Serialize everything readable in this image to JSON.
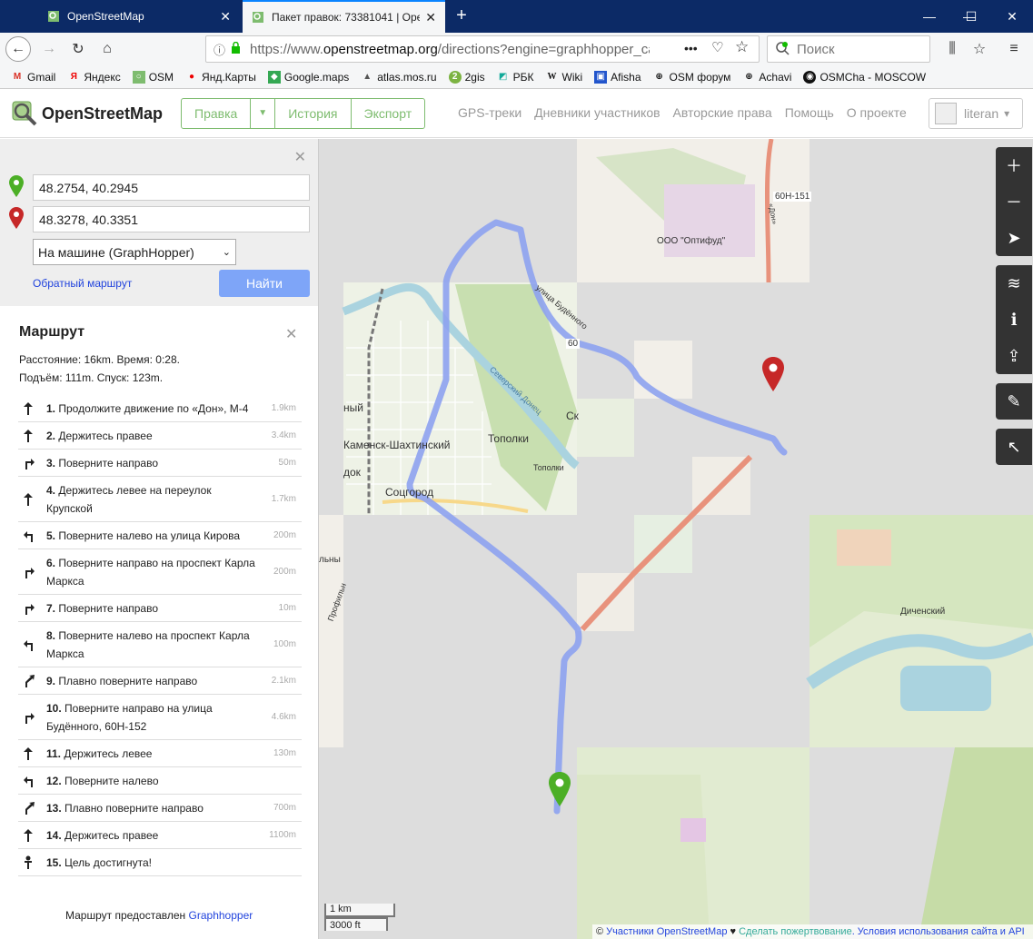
{
  "browser": {
    "tabs": [
      {
        "title": "OpenStreetMap",
        "active": false
      },
      {
        "title": "Пакет правок: 73381041 | OpenStreetMap",
        "active": true
      }
    ],
    "url_prefix": "https://www.",
    "url_domain": "openstreetmap.org",
    "url_path": "/directions?engine=graphhopper_car&r",
    "search_placeholder": "Поиск",
    "bookmarks": [
      "Gmail",
      "Яндекс",
      "OSM",
      "Янд.Карты",
      "Google.maps",
      "atlas.mos.ru",
      "2gis",
      "РБК",
      "Wiki",
      "Afisha",
      "OSM форум",
      "Achavi",
      "OSMCha - MOSCOW"
    ]
  },
  "osm": {
    "logo": "OpenStreetMap",
    "edit": "Правка",
    "history": "История",
    "export": "Экспорт",
    "links": [
      "GPS-треки",
      "Дневники участников",
      "Авторские права",
      "Помощь",
      "О проекте"
    ],
    "user": "literan",
    "user_caret": "▾"
  },
  "directions": {
    "from": "48.2754, 40.2945",
    "to": "48.3278, 40.3351",
    "engine": "На машине (GraphHopper)",
    "reverse": "Обратный маршрут",
    "go": "Найти"
  },
  "route": {
    "title": "Маршрут",
    "summary1": "Расстояние: 16km. Время: 0:28.",
    "summary2": "Подъём: 111m. Спуск: 123m.",
    "steps": [
      {
        "n": "1.",
        "text": "Продолжите движение по «Дон», M-4",
        "dist": "1.9km",
        "icon": "straight"
      },
      {
        "n": "2.",
        "text": "Держитесь правее",
        "dist": "3.4km",
        "icon": "straight"
      },
      {
        "n": "3.",
        "text": "Поверните направо",
        "dist": "50m",
        "icon": "right"
      },
      {
        "n": "4.",
        "text": "Держитесь левее на переулок Крупской",
        "dist": "1.7km",
        "icon": "straight"
      },
      {
        "n": "5.",
        "text": "Поверните налево на улица Кирова",
        "dist": "200m",
        "icon": "left"
      },
      {
        "n": "6.",
        "text": "Поверните направо на проспект Карла Маркса",
        "dist": "200m",
        "icon": "right"
      },
      {
        "n": "7.",
        "text": "Поверните направо",
        "dist": "10m",
        "icon": "right"
      },
      {
        "n": "8.",
        "text": "Поверните налево на проспект Карла Маркса",
        "dist": "100m",
        "icon": "left"
      },
      {
        "n": "9.",
        "text": "Плавно поверните направо",
        "dist": "2.1km",
        "icon": "slight-right"
      },
      {
        "n": "10.",
        "text": "Поверните направо на улица Будённого, 60Н-152",
        "dist": "4.6km",
        "icon": "right"
      },
      {
        "n": "11.",
        "text": "Держитесь левее",
        "dist": "130m",
        "icon": "straight"
      },
      {
        "n": "12.",
        "text": "Поверните налево",
        "dist": "",
        "icon": "left"
      },
      {
        "n": "13.",
        "text": "Плавно поверните направо",
        "dist": "700m",
        "icon": "slight-right"
      },
      {
        "n": "14.",
        "text": "Держитесь правее",
        "dist": "1100m",
        "icon": "straight"
      },
      {
        "n": "15.",
        "text": "Цель достигнута!",
        "dist": "",
        "icon": "destination"
      }
    ],
    "credit_prefix": "Маршрут предоставлен ",
    "credit_link": "Graphhopper"
  },
  "map": {
    "labels": {
      "kamensk": "Каменск-Шахтинский",
      "topolki": "Тополки",
      "topolki2": "Тополки",
      "socgorod": "Соцгород",
      "dichensky": "Диченский",
      "optifud": "ООО \"Оптифуд\"",
      "road": "60Н-151",
      "budennogo": "улица Будённого",
      "don_river": "Северский Донец",
      "don_road": "«Дон»",
      "n60": "60",
      "ny": "ный",
      "dok": "док",
      "sk": "Ск",
      "elny": "льны",
      "profil": "Профильн"
    },
    "scale_km": "1 km",
    "scale_ft": "3000 ft",
    "attrib_c": "© ",
    "attrib_osm": "Участники OpenStreetMap",
    "attrib_heart": " ♥ ",
    "attrib_donate": "Сделать пожертвование",
    "attrib_terms": ". Условия использования сайта и API"
  },
  "colors": {
    "osm_green": "#7ebc6f",
    "route_line": "#8da2f0",
    "start_pin": "#4caf26",
    "end_pin": "#c62828",
    "tab_bar": "#0c2a66"
  }
}
